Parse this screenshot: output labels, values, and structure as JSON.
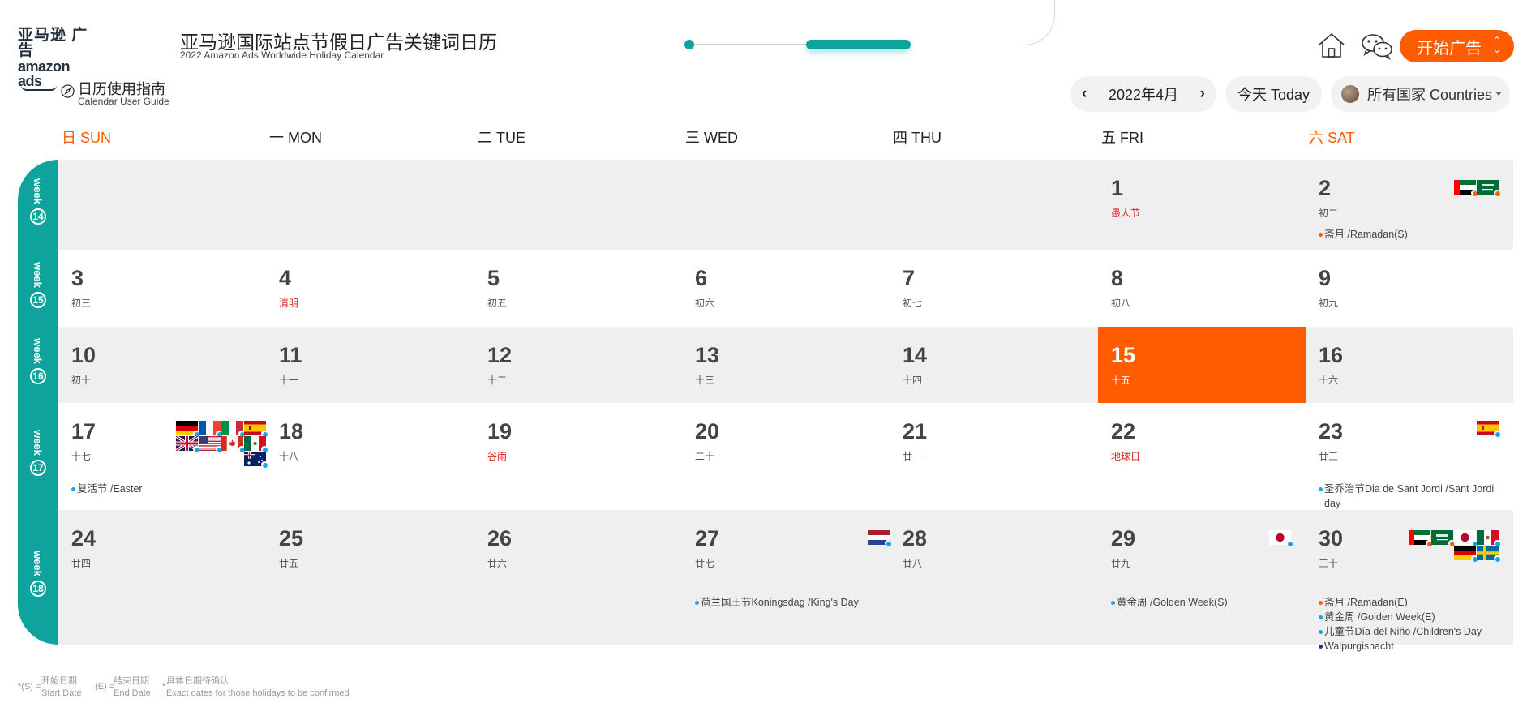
{
  "header": {
    "logo_cn": "亚马逊 广告",
    "logo_en": "amazon ads",
    "title_cn": "亚马逊国际站点节假日广告关键词日历",
    "title_en": "2022 Amazon Ads Worldwide Holiday Calendar",
    "start_button": "开始广告"
  },
  "guide": {
    "cn": "日历使用指南",
    "en": "Calendar User Guide"
  },
  "toolbar": {
    "prev": "‹",
    "month": "2022年4月",
    "next": "›",
    "today": "今天 Today",
    "country": "所有国家 Countries"
  },
  "weekdays": [
    "日 SUN",
    "一 MON",
    "二 TUE",
    "三 WED",
    "四 THU",
    "五 FRI",
    "六 SAT"
  ],
  "weeks": [
    {
      "label": "week",
      "num": "14",
      "days": [
        null,
        null,
        null,
        null,
        null,
        {
          "d": "1",
          "lunar": "愚人节",
          "red": true
        },
        {
          "d": "2",
          "lunar": "初二",
          "flags": [
            "ae",
            "sa"
          ],
          "events": [
            {
              "c": "orange",
              "t": "斋月 /Ramadan(S)"
            }
          ]
        }
      ]
    },
    {
      "label": "week",
      "num": "15",
      "days": [
        {
          "d": "3",
          "lunar": "初三"
        },
        {
          "d": "4",
          "lunar": "清明",
          "red": true
        },
        {
          "d": "5",
          "lunar": "初五"
        },
        {
          "d": "6",
          "lunar": "初六"
        },
        {
          "d": "7",
          "lunar": "初七"
        },
        {
          "d": "8",
          "lunar": "初八"
        },
        {
          "d": "9",
          "lunar": "初九"
        }
      ]
    },
    {
      "label": "week",
      "num": "16",
      "days": [
        {
          "d": "10",
          "lunar": "初十"
        },
        {
          "d": "11",
          "lunar": "十一"
        },
        {
          "d": "12",
          "lunar": "十二"
        },
        {
          "d": "13",
          "lunar": "十三"
        },
        {
          "d": "14",
          "lunar": "十四"
        },
        {
          "d": "15",
          "lunar": "十五",
          "today": true
        },
        {
          "d": "16",
          "lunar": "十六"
        }
      ]
    },
    {
      "label": "week",
      "num": "17",
      "days": [
        {
          "d": "17",
          "lunar": "十七",
          "flags": [
            "de",
            "fr",
            "it",
            "es",
            "gb",
            "us",
            "ca",
            "mx",
            "au"
          ],
          "events": [
            {
              "c": "blue",
              "t": "复活节 /Easter"
            }
          ]
        },
        {
          "d": "18",
          "lunar": "十八"
        },
        {
          "d": "19",
          "lunar": "谷雨",
          "red": true
        },
        {
          "d": "20",
          "lunar": "二十"
        },
        {
          "d": "21",
          "lunar": "廿一"
        },
        {
          "d": "22",
          "lunar": "地球日",
          "red": true
        },
        {
          "d": "23",
          "lunar": "廿三",
          "flags": [
            "es"
          ],
          "events": [
            {
              "c": "blue",
              "t": "圣乔治节Dia de Sant Jordi /Sant Jordi day"
            }
          ]
        }
      ]
    },
    {
      "label": "week",
      "num": "18",
      "days": [
        {
          "d": "24",
          "lunar": "廿四"
        },
        {
          "d": "25",
          "lunar": "廿五"
        },
        {
          "d": "26",
          "lunar": "廿六"
        },
        {
          "d": "27",
          "lunar": "廿七",
          "flags": [
            "nl"
          ],
          "events": [
            {
              "c": "blue",
              "t": "荷兰国王节Koningsdag /King's Day"
            }
          ]
        },
        {
          "d": "28",
          "lunar": "廿八"
        },
        {
          "d": "29",
          "lunar": "廿九",
          "flags": [
            "jp"
          ],
          "events": [
            {
              "c": "blue",
              "t": "黄金周 /Golden Week(S)"
            }
          ]
        },
        {
          "d": "30",
          "lunar": "三十",
          "flags": [
            "ae",
            "sa",
            "jp",
            "mx",
            "de",
            "se"
          ],
          "events": [
            {
              "c": "orange",
              "t": "斋月 /Ramadan(E)"
            },
            {
              "c": "blue",
              "t": "黄金周 /Golden Week(E)"
            },
            {
              "c": "blue",
              "t": "儿童节Día del Niño /Children's Day"
            },
            {
              "c": "navy",
              "t": "Walpurgisnacht"
            }
          ]
        }
      ]
    }
  ],
  "legend": {
    "s_key": "*(S) =",
    "s_cn": "开始日期",
    "s_en": "Start Date",
    "e_key": "(E) =",
    "e_cn": "结束日期",
    "e_en": "End Date",
    "x_key": "*",
    "x_cn": "具体日期待确认",
    "x_en": "Exact dates for those holidays to be confirmed"
  },
  "colors": {
    "accent": "#ff5b00",
    "teal": "#0fa39e",
    "gray_row": "#efefef"
  }
}
